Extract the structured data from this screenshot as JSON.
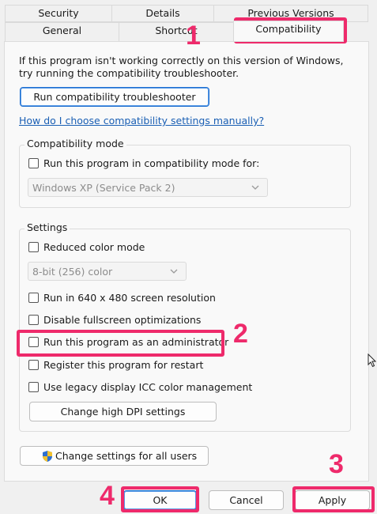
{
  "tabs": {
    "row1": [
      "Security",
      "Details",
      "Previous Versions"
    ],
    "row2": [
      "General",
      "Shortcut",
      "Compatibility"
    ]
  },
  "intro_text": "If this program isn't working correctly on this version of Windows, try running the compatibility troubleshooter.",
  "troubleshooter_button": "Run compatibility troubleshooter",
  "help_link": "How do I choose compatibility settings manually?",
  "compat_mode": {
    "title": "Compatibility mode",
    "checkbox": "Run this program in compatibility mode for:",
    "os_select": "Windows XP (Service Pack 2)"
  },
  "settings": {
    "title": "Settings",
    "reduced_color": "Reduced color mode",
    "color_select": "8-bit (256) color",
    "res_640": "Run in 640 x 480 screen resolution",
    "disable_fullscreen": "Disable fullscreen optimizations",
    "run_admin": "Run this program as an administrator",
    "register_restart": "Register this program for restart",
    "legacy_icc": "Use legacy display ICC color management",
    "dpi_button": "Change high DPI settings"
  },
  "all_users_button": "Change settings for all users",
  "footer": {
    "ok": "OK",
    "cancel": "Cancel",
    "apply": "Apply"
  },
  "annotations": [
    "1",
    "2",
    "3",
    "4"
  ],
  "colors": {
    "highlight": "#ee2a6b",
    "link": "#1a5fb4"
  }
}
